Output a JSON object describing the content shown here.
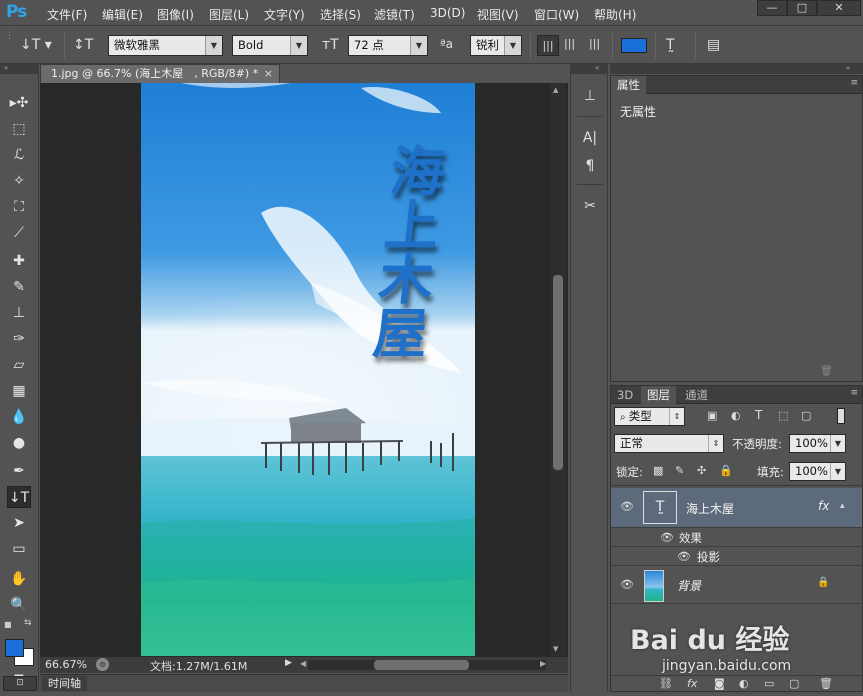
{
  "app": {
    "logo": "Ps"
  },
  "menu": [
    "文件(F)",
    "编辑(E)",
    "图像(I)",
    "图层(L)",
    "文字(Y)",
    "选择(S)",
    "滤镜(T)",
    "3D(D)",
    "视图(V)",
    "窗口(W)",
    "帮助(H)"
  ],
  "window_controls": {
    "minimize": "—",
    "restore": "□",
    "close": "✕"
  },
  "options": {
    "font_family": "微软雅黑",
    "font_style": "Bold",
    "font_size": "72 点",
    "antialias_label": "ªa",
    "antialias": "锐利",
    "text_color": "#1a6fd8"
  },
  "document": {
    "tab_title": "1.jpg @ 66.7% (海上木屋　, RGB/8#) *",
    "tab_close": "×",
    "canvas_text": "海上木屋"
  },
  "status": {
    "zoom": "66.67%",
    "doc_info": "文档:1.27M/1.61M"
  },
  "timeline": {
    "label": "时间轴"
  },
  "properties_panel": {
    "tab": "属性",
    "content": "无属性"
  },
  "layers_panel": {
    "tabs": [
      "3D",
      "图层",
      "通道"
    ],
    "active_tab": "图层",
    "filter_kind": "类型",
    "blend_mode": "正常",
    "opacity_label": "不透明度:",
    "opacity": "100%",
    "lock_label": "锁定:",
    "fill_label": "填充:",
    "fill": "100%",
    "layers": [
      {
        "name": "海上木屋",
        "type": "text",
        "fx": "fx",
        "effects_label": "效果",
        "effects": [
          "投影"
        ]
      },
      {
        "name": "背景",
        "type": "image",
        "locked": true
      }
    ]
  },
  "watermark": {
    "brand": "Bai du 经验",
    "url": "jingyan.baidu.com"
  }
}
